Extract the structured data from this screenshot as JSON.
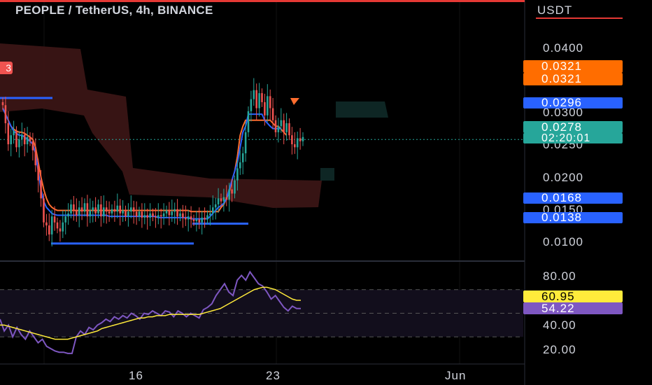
{
  "header": {
    "title": "PEOPLE / TetherUS, 4h, BINANCE"
  },
  "price_axis": {
    "currency": "USDT",
    "ticks": [
      "0.0400",
      "0.0300",
      "0.0250",
      "0.0200",
      "0.0150",
      "0.0100"
    ]
  },
  "rsi_axis": {
    "ticks": [
      "80.00",
      "40.00",
      "20.00"
    ]
  },
  "time_axis": {
    "labels": [
      "16",
      "23",
      "Jun"
    ]
  },
  "badges": {
    "upper1": "0.0321",
    "upper2": "0.0321",
    "blue1": "0.0296",
    "last_price": "0.0278",
    "countdown": "02:20:01",
    "blue2": "0.0168",
    "blue3": "0.0138",
    "rsi_ma": "60.95",
    "rsi": "54.22"
  },
  "left_tag": "3",
  "colors": {
    "background": "#000000",
    "up": "#26a69a",
    "down": "#ef5350",
    "cloud": "#3d1616",
    "fast_line": "#ff6d2e",
    "slow_line": "#2962ff",
    "rsi": "#7e57c2",
    "rsi_ma": "#ffeb3b"
  },
  "chart_data": [
    {
      "type": "candlestick",
      "title": "PEOPLE / TetherUS, 4h, BINANCE",
      "ylabel": "USDT",
      "ylim": [
        0.0085,
        0.0475
      ],
      "x_ticks": [
        "16",
        "23",
        "Jun"
      ],
      "last_price": 0.0278,
      "ohlc_series": {
        "name": "price",
        "close": [
          0.0335,
          0.0305,
          0.027,
          0.0285,
          0.0292,
          0.0265,
          0.0278,
          0.0286,
          0.027,
          0.0282,
          0.0275,
          0.026,
          0.0235,
          0.021,
          0.018,
          0.014,
          0.0135,
          0.012,
          0.015,
          0.014,
          0.013,
          0.0125,
          0.014,
          0.015,
          0.0155,
          0.017,
          0.016,
          0.0152,
          0.0165,
          0.0158,
          0.0172,
          0.015,
          0.016,
          0.0165,
          0.0155,
          0.017,
          0.015,
          0.0165,
          0.0158,
          0.0155,
          0.0162,
          0.0158,
          0.0168,
          0.0155,
          0.016,
          0.015,
          0.0158,
          0.0165,
          0.0158,
          0.015,
          0.0158,
          0.0148,
          0.0152,
          0.0148,
          0.0155,
          0.015,
          0.0148,
          0.0152,
          0.015,
          0.0155,
          0.016,
          0.0152,
          0.0158,
          0.0162,
          0.015,
          0.0155,
          0.0148,
          0.0145,
          0.015,
          0.0145,
          0.0142,
          0.0145,
          0.014,
          0.0148,
          0.0145,
          0.0152,
          0.0155,
          0.0165,
          0.017,
          0.018,
          0.0175,
          0.0182,
          0.0178,
          0.0195,
          0.0188,
          0.021,
          0.023,
          0.024,
          0.0255,
          0.029,
          0.0325,
          0.0345,
          0.036,
          0.033,
          0.0355,
          0.034,
          0.0318,
          0.035,
          0.033,
          0.031,
          0.029,
          0.03,
          0.031,
          0.029,
          0.0305,
          0.0285,
          0.027,
          0.0265,
          0.028,
          0.0275,
          0.0282
        ],
        "open": [
          0.034,
          0.0335,
          0.0305,
          0.027,
          0.0285,
          0.0292,
          0.0265,
          0.0278,
          0.0286,
          0.027,
          0.0282,
          0.0275,
          0.026,
          0.0235,
          0.021,
          0.018,
          0.014,
          0.0135,
          0.012,
          0.015,
          0.014,
          0.013,
          0.0125,
          0.014,
          0.015,
          0.0155,
          0.017,
          0.016,
          0.0152,
          0.0165,
          0.0158,
          0.0172,
          0.015,
          0.016,
          0.0165,
          0.0155,
          0.017,
          0.015,
          0.0165,
          0.0158,
          0.0155,
          0.0162,
          0.0158,
          0.0168,
          0.0155,
          0.016,
          0.015,
          0.0158,
          0.0165,
          0.0158,
          0.015,
          0.0158,
          0.0148,
          0.0152,
          0.0148,
          0.0155,
          0.015,
          0.0148,
          0.0152,
          0.015,
          0.0155,
          0.016,
          0.0152,
          0.0158,
          0.0162,
          0.015,
          0.0155,
          0.0148,
          0.0145,
          0.015,
          0.0145,
          0.0142,
          0.0145,
          0.014,
          0.0148,
          0.0145,
          0.0152,
          0.0155,
          0.0165,
          0.017,
          0.018,
          0.0175,
          0.0182,
          0.0178,
          0.0195,
          0.0188,
          0.021,
          0.023,
          0.024,
          0.0255,
          0.029,
          0.0325,
          0.0345,
          0.036,
          0.033,
          0.0355,
          0.034,
          0.0318,
          0.035,
          0.033,
          0.031,
          0.029,
          0.03,
          0.031,
          0.029,
          0.0305,
          0.0285,
          0.027,
          0.0265,
          0.028,
          0.0275
        ]
      },
      "lines": [
        {
          "name": "fast",
          "values": [
            0.033,
            0.032,
            0.031,
            0.03,
            0.0295,
            0.0292,
            0.029,
            0.029,
            0.0288,
            0.0285,
            0.0282,
            0.0278,
            0.0265,
            0.024,
            0.0215,
            0.0195,
            0.018,
            0.017,
            0.0165,
            0.0162,
            0.016,
            0.016,
            0.016,
            0.016,
            0.016,
            0.016,
            0.016,
            0.016,
            0.016,
            0.016,
            0.016,
            0.016,
            0.016,
            0.016,
            0.016,
            0.016,
            0.016,
            0.016,
            0.016,
            0.016,
            0.016,
            0.016,
            0.016,
            0.016,
            0.016,
            0.016,
            0.016,
            0.016,
            0.016,
            0.016,
            0.016,
            0.016,
            0.016,
            0.016,
            0.016,
            0.016,
            0.016,
            0.016,
            0.016,
            0.016,
            0.016,
            0.016,
            0.016,
            0.016,
            0.016,
            0.016,
            0.016,
            0.016,
            0.016,
            0.0158,
            0.0158,
            0.0158,
            0.0158,
            0.0158,
            0.0158,
            0.0158,
            0.0158,
            0.0158,
            0.0158,
            0.0158,
            0.0165,
            0.017,
            0.018,
            0.019,
            0.021,
            0.0225,
            0.025,
            0.0285,
            0.03,
            0.031,
            0.031,
            0.031,
            0.031,
            0.031,
            0.031,
            0.031,
            0.031,
            0.031,
            0.031,
            0.0305,
            0.03,
            0.03,
            0.0295,
            0.029,
            0.0285
          ]
        },
        {
          "name": "slow",
          "values": [
            0.033,
            0.032,
            0.031,
            0.03,
            0.0292,
            0.0288,
            0.0285,
            0.0285,
            0.0282,
            0.0278,
            0.0275,
            0.027,
            0.0255,
            0.0225,
            0.0195,
            0.0175,
            0.0165,
            0.016,
            0.0155,
            0.0153,
            0.0152,
            0.0152,
            0.0152,
            0.0152,
            0.0152,
            0.0152,
            0.0152,
            0.0152,
            0.0152,
            0.0152,
            0.0152,
            0.0152,
            0.0152,
            0.0152,
            0.0152,
            0.0152,
            0.0152,
            0.0152,
            0.0152,
            0.015,
            0.015,
            0.015,
            0.015,
            0.015,
            0.015,
            0.015,
            0.015,
            0.015,
            0.015,
            0.015,
            0.015,
            0.015,
            0.015,
            0.015,
            0.015,
            0.015,
            0.015,
            0.0148,
            0.0148,
            0.0148,
            0.0148,
            0.0148,
            0.0148,
            0.0148,
            0.0148,
            0.0148,
            0.0148,
            0.0148,
            0.0148,
            0.0146,
            0.0146,
            0.0146,
            0.0146,
            0.0146,
            0.0146,
            0.0146,
            0.015,
            0.0155,
            0.016,
            0.0165,
            0.0168,
            0.0172,
            0.018,
            0.0195,
            0.021,
            0.0225,
            0.024,
            0.0265,
            0.029,
            0.03,
            0.032,
            0.032,
            0.032,
            0.032,
            0.032,
            0.032,
            0.031,
            0.0305,
            0.03,
            0.0296,
            0.0296,
            0.0296,
            0.0296
          ]
        }
      ],
      "levels": [
        {
          "name": "level-a",
          "value": 0.0347
        },
        {
          "name": "level-b",
          "value": 0.0138
        },
        {
          "name": "level-c",
          "value": 0.0105
        }
      ]
    },
    {
      "type": "line",
      "ylim": [
        10,
        90
      ],
      "y_ticks": [
        "80.00",
        "40.00",
        "20.00"
      ],
      "bands": [
        70,
        50,
        30
      ],
      "series": [
        {
          "name": "rsi",
          "values": [
            45,
            35,
            40,
            30,
            38,
            32,
            28,
            35,
            30,
            25,
            28,
            22,
            20,
            18,
            17,
            17,
            16,
            16,
            30,
            35,
            32,
            38,
            36,
            40,
            42,
            45,
            43,
            47,
            45,
            48,
            46,
            50,
            48,
            45,
            50,
            49,
            52,
            50,
            48,
            52,
            51,
            47,
            52,
            50,
            47,
            50,
            48,
            46,
            53,
            55,
            58,
            65,
            70,
            75,
            68,
            65,
            78,
            82,
            78,
            85,
            80,
            75,
            73,
            68,
            62,
            65,
            60,
            55,
            52,
            56,
            54,
            54
          ]
        },
        {
          "name": "rsi-ma",
          "values": [
            40,
            40,
            39,
            38,
            37,
            36,
            35,
            34,
            33,
            32,
            31,
            30,
            29,
            28,
            28,
            28,
            28,
            29,
            30,
            31,
            32,
            33,
            34,
            35,
            37,
            38,
            39,
            40,
            41,
            42,
            43,
            44,
            45,
            46,
            46,
            47,
            47,
            48,
            48,
            48,
            49,
            49,
            49,
            49,
            49,
            49,
            49,
            49,
            50,
            51,
            52,
            53,
            54,
            56,
            58,
            60,
            62,
            64,
            66,
            68,
            70,
            71,
            72,
            72,
            71,
            70,
            68,
            66,
            64,
            62,
            61,
            61
          ]
        }
      ]
    }
  ]
}
